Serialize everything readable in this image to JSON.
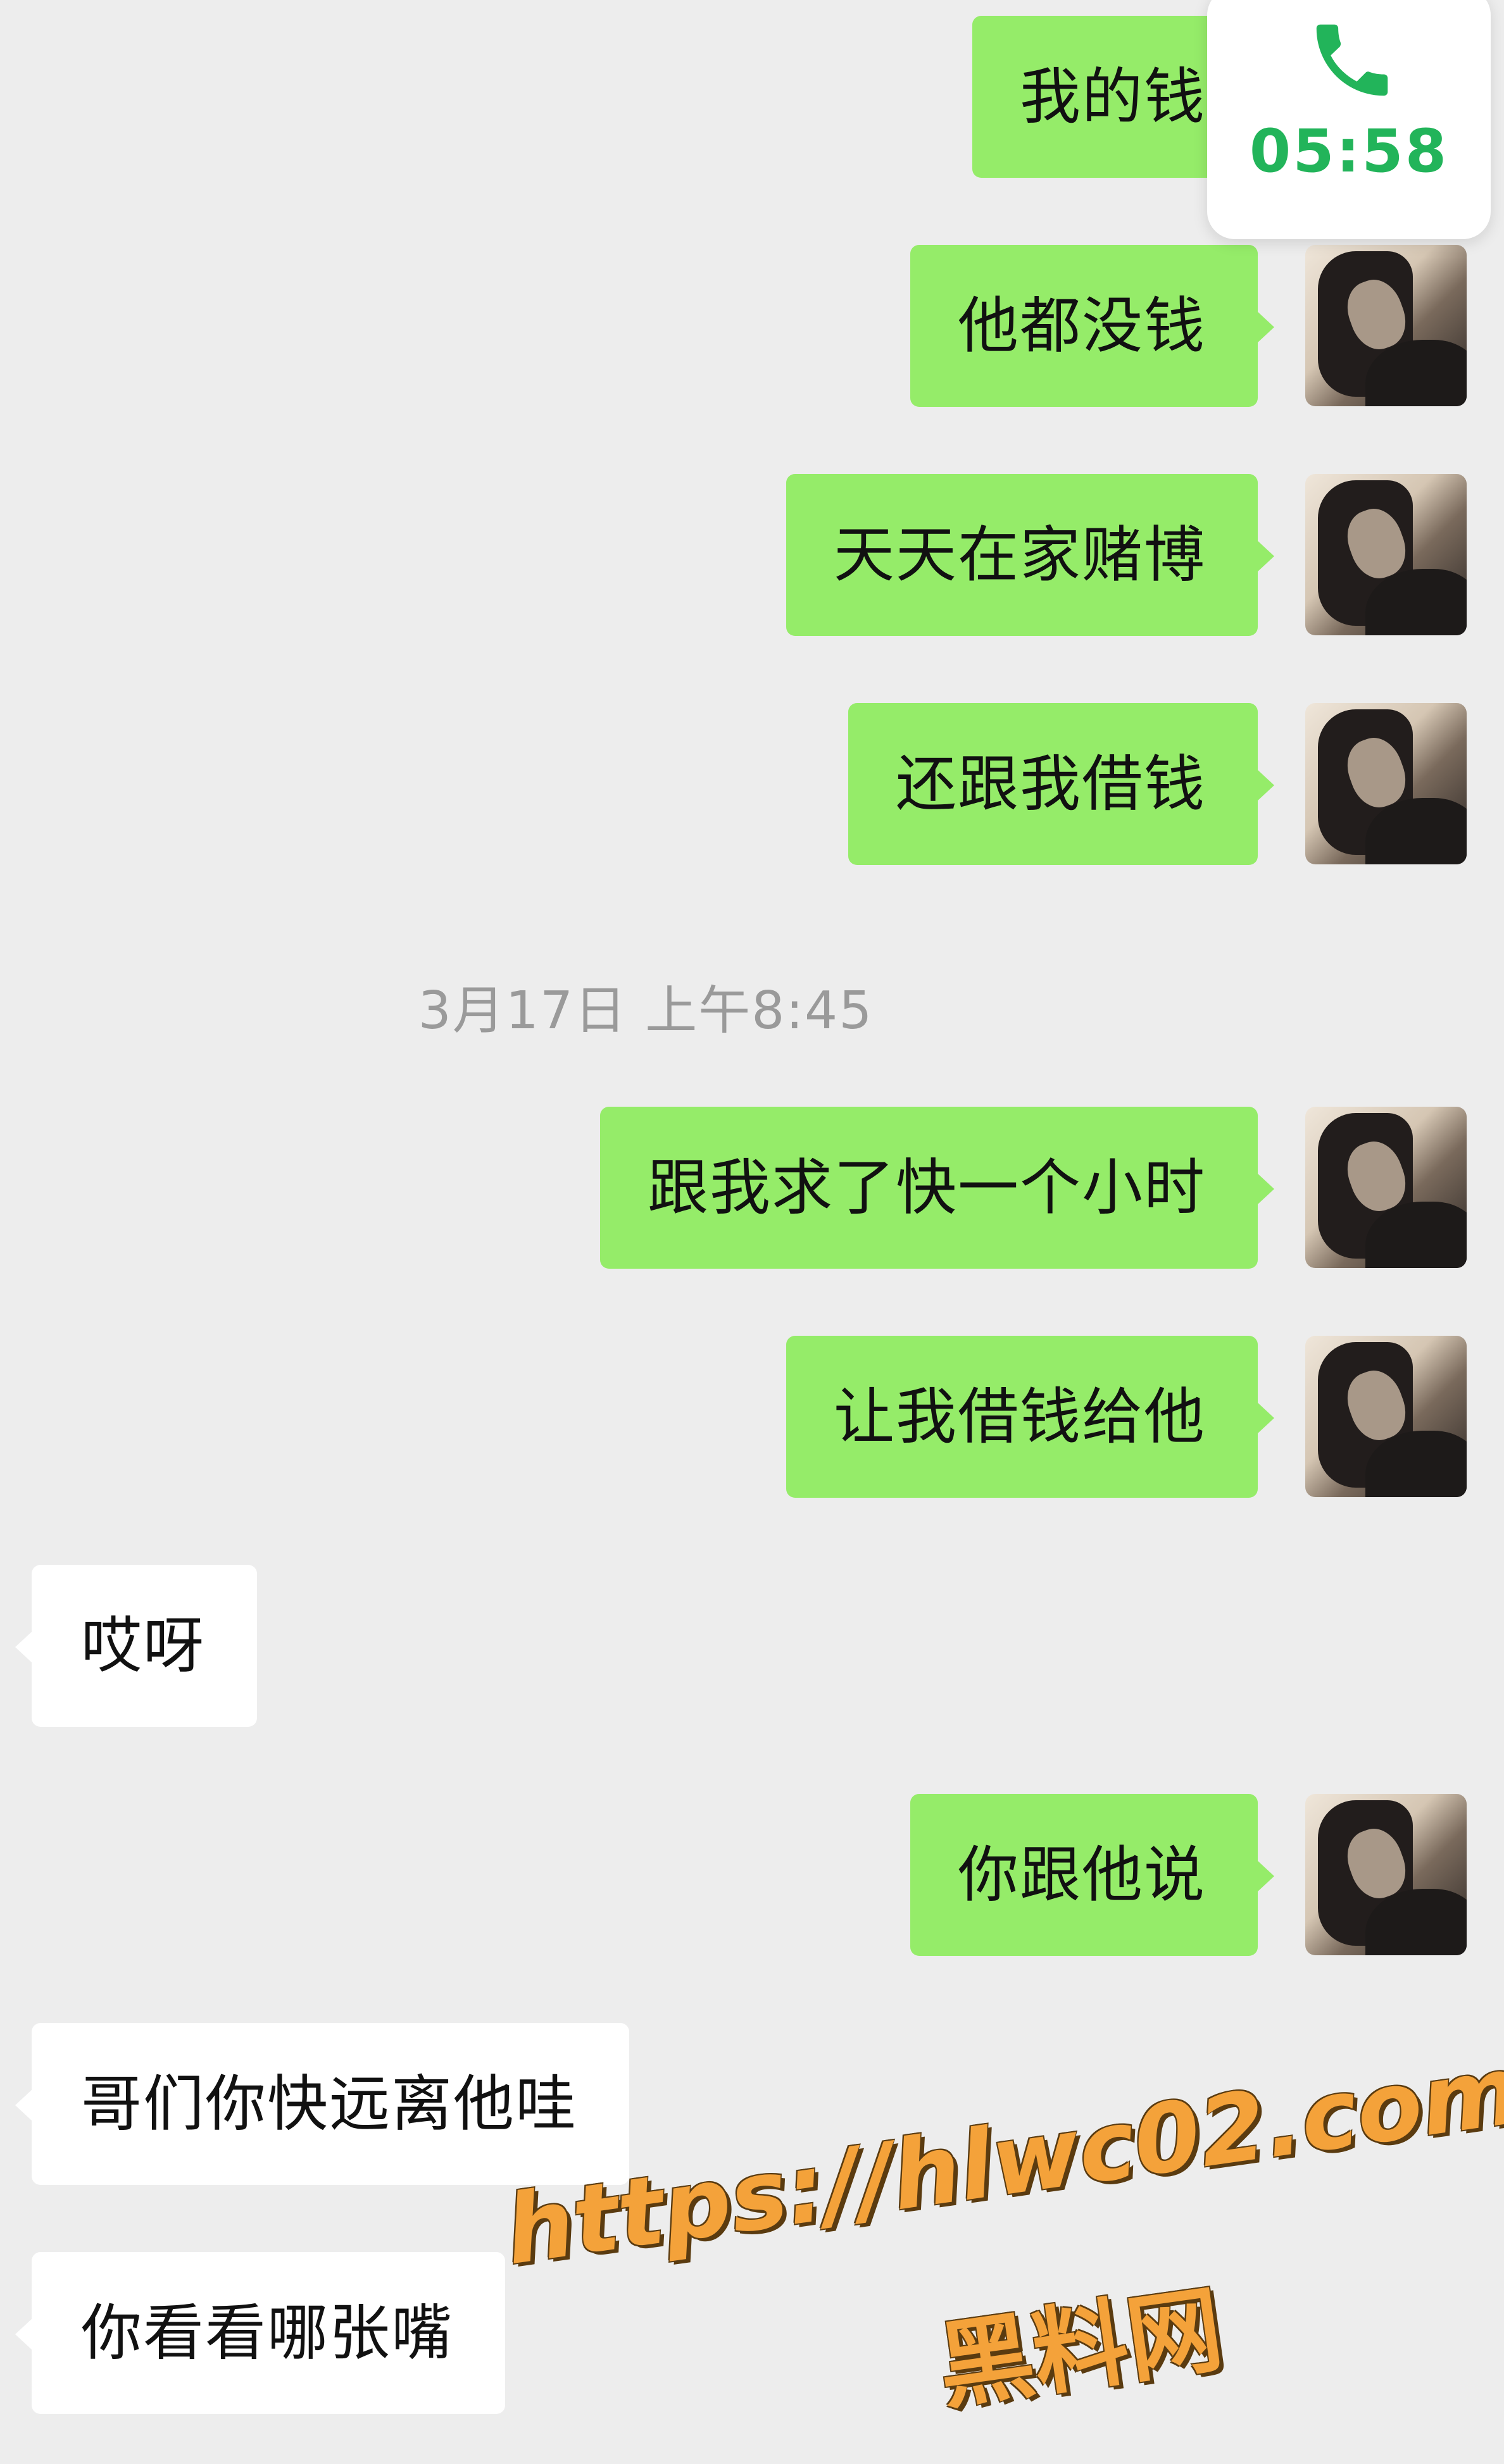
{
  "call_widget": {
    "icon": "phone-icon",
    "timer": "05:58",
    "accent_color": "#22B45A"
  },
  "chat": {
    "outgoing_bubble_color": "#95EC69",
    "incoming_bubble_color": "#FFFFFF",
    "timestamp": "3月17日 上午8:45",
    "messages": [
      {
        "side": "out",
        "text": "我的钱"
      },
      {
        "side": "out",
        "text": "他都没钱"
      },
      {
        "side": "out",
        "text": "天天在家赌博"
      },
      {
        "side": "out",
        "text": "还跟我借钱"
      },
      {
        "side": "out",
        "text": "跟我求了快一个小时"
      },
      {
        "side": "out",
        "text": "让我借钱给他"
      },
      {
        "side": "in",
        "text": "哎呀"
      },
      {
        "side": "out",
        "text": "你跟他说"
      },
      {
        "side": "in",
        "text": "哥们你快远离他哇"
      },
      {
        "side": "in",
        "text": "你看看哪张嘴"
      }
    ]
  },
  "watermark": {
    "url": "https://hlwc02.com",
    "site": "黑料网"
  }
}
